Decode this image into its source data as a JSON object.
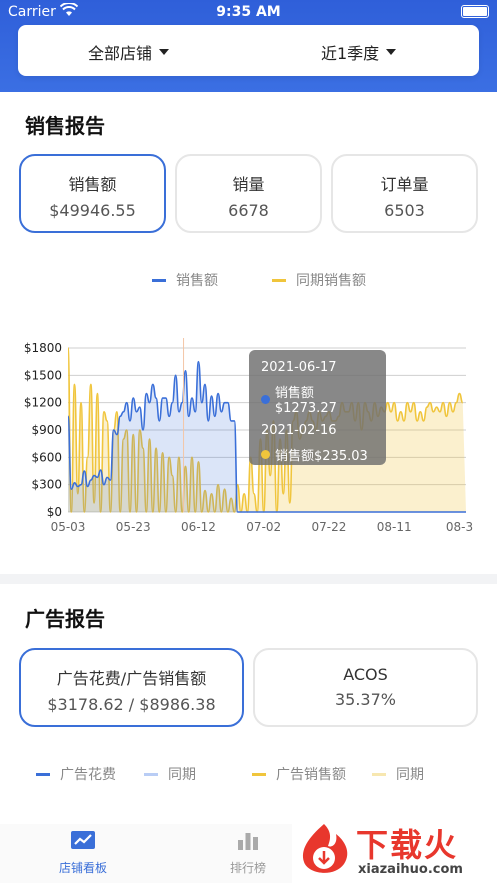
{
  "status": {
    "carrier": "Carrier",
    "time": "9:35 AM"
  },
  "filters": {
    "store": "全部店铺",
    "period": "近1季度"
  },
  "sales": {
    "title": "销售报告",
    "cards": [
      {
        "label": "销售额",
        "value": "$49946.55",
        "active": true
      },
      {
        "label": "销量",
        "value": "6678",
        "active": false
      },
      {
        "label": "订单量",
        "value": "6503",
        "active": false
      }
    ],
    "legend": [
      {
        "label": "销售额",
        "color": "#3a6fd8"
      },
      {
        "label": "同期销售额",
        "color": "#f0c53c"
      }
    ]
  },
  "tooltip": {
    "date1": "2021-06-17",
    "item1": "销售额$1273.27",
    "date2": "2021-02-16",
    "item2": "销售额$235.03"
  },
  "chart_data": {
    "type": "line",
    "yticks": [
      "$1800",
      "$1500",
      "$1200",
      "$900",
      "$600",
      "$300",
      "$0"
    ],
    "ylim": [
      0,
      1800
    ],
    "xticks": [
      "05-03",
      "05-23",
      "06-12",
      "07-02",
      "07-22",
      "08-11",
      "08-3"
    ],
    "x_days": [
      0,
      20,
      40,
      60,
      80,
      100,
      120
    ],
    "series": [
      {
        "name": "销售额",
        "color": "#3a6fd8",
        "values": [
          1050,
          250,
          320,
          280,
          300,
          450,
          280,
          350,
          400,
          380,
          460,
          300,
          380,
          350,
          900,
          850,
          1050,
          1100,
          1200,
          1000,
          1250,
          1100,
          1150,
          900,
          1300,
          1200,
          1400,
          1250,
          1000,
          1250,
          1250,
          1050,
          1200,
          1500,
          1100,
          1200,
          1550,
          1050,
          1250,
          1100,
          1650,
          1200,
          1400,
          1000,
          1273,
          1050,
          1300,
          1100,
          1200,
          1200,
          1000,
          1000,
          0,
          0,
          0,
          0,
          0,
          0,
          0,
          0,
          0,
          0,
          0,
          0,
          0,
          0,
          0,
          0,
          0,
          0,
          0,
          0,
          0,
          0,
          0,
          0,
          0,
          0,
          0,
          0,
          0,
          0,
          0,
          0,
          0,
          0,
          0,
          0,
          0,
          0,
          0,
          0,
          0,
          0,
          0,
          0,
          0,
          0,
          0,
          0,
          0,
          0,
          0,
          0,
          0,
          0,
          0,
          0,
          0,
          0,
          0,
          0,
          0,
          0,
          0,
          0,
          0,
          0,
          0,
          0,
          0,
          0,
          0
        ]
      },
      {
        "name": "同期销售额",
        "color": "#f0c53c",
        "values": [
          1800,
          0,
          1400,
          200,
          1200,
          0,
          600,
          1400,
          100,
          1300,
          0,
          1100,
          1000,
          0,
          900,
          1100,
          0,
          800,
          900,
          0,
          850,
          0,
          900,
          700,
          0,
          800,
          0,
          700,
          0,
          650,
          0,
          600,
          400,
          0,
          600,
          0,
          500,
          0,
          600,
          0,
          550,
          0,
          235,
          0,
          200,
          0,
          300,
          0,
          250,
          0,
          150,
          0,
          300,
          0,
          200,
          0,
          600,
          200,
          0,
          800,
          0,
          900,
          400,
          1000,
          0,
          800,
          200,
          900,
          100,
          1000,
          1100,
          800,
          900,
          1000,
          1100,
          1000,
          900,
          1100,
          1000,
          1050,
          1100,
          1000,
          1000,
          1050,
          1200,
          1100,
          1100,
          1200,
          1000,
          1200,
          900,
          1200,
          1100,
          1000,
          1200,
          1050,
          1150,
          1100,
          1200,
          1100,
          1200,
          1000,
          1100,
          1000,
          1200,
          1100,
          1200,
          1000,
          1100,
          1000,
          1150,
          1200,
          1100,
          1150,
          1100,
          1200,
          1050,
          1200,
          1100,
          1200,
          1300,
          1200
        ]
      }
    ]
  },
  "ads": {
    "title": "广告报告",
    "cards": [
      {
        "label": "广告花费/广告销售额",
        "value": "$3178.62 / $8986.38",
        "active": true
      },
      {
        "label": "ACOS",
        "value": "35.37%",
        "active": false
      }
    ],
    "legend": [
      {
        "label": "广告花费",
        "color": "#3a6fd8"
      },
      {
        "label": "同期",
        "color": "#b9cdf5"
      },
      {
        "label": "广告销售额",
        "color": "#f0c53c"
      },
      {
        "label": "同期",
        "color": "#f7e7b0"
      }
    ]
  },
  "tabs": [
    {
      "label": "店铺看板",
      "active": true,
      "icon": "chart-line-icon",
      "color": "#3a6fd8"
    },
    {
      "label": "排行榜",
      "active": false,
      "icon": "bar-chart-icon",
      "color": "#999999"
    }
  ],
  "watermark": {
    "text": "下载火",
    "url": "xiazaihuo.com"
  }
}
